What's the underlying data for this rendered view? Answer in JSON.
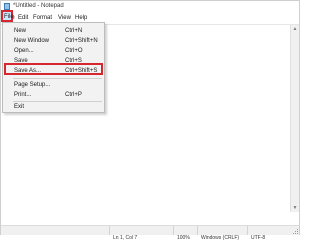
{
  "window": {
    "title": "*Untitled - Notepad"
  },
  "menubar": {
    "items": [
      "File",
      "Edit",
      "Format",
      "View",
      "Help"
    ]
  },
  "file_menu": {
    "items": [
      {
        "label": "New",
        "shortcut": "Ctrl+N"
      },
      {
        "label": "New Window",
        "shortcut": "Ctrl+Shift+N"
      },
      {
        "label": "Open...",
        "shortcut": "Ctrl+O"
      },
      {
        "label": "Save",
        "shortcut": "Ctrl+S"
      },
      {
        "label": "Save As...",
        "shortcut": "Ctrl+Shift+S"
      },
      {
        "label": "Page Setup...",
        "shortcut": ""
      },
      {
        "label": "Print...",
        "shortcut": "Ctrl+P"
      },
      {
        "label": "Exit",
        "shortcut": ""
      }
    ]
  },
  "statusbar": {
    "position": "Ln 1, Col 7",
    "zoom": "100%",
    "line_ending": "Windows (CRLF)",
    "encoding": "UTF-8"
  },
  "colors": {
    "highlight_outline": "#d6262f",
    "menu_active_bg": "#cce8ff"
  },
  "icons": {
    "app": "notepad-icon",
    "scroll_up": "scroll-up-arrow-icon",
    "scroll_down": "scroll-down-arrow-icon",
    "resize": "resize-grip-icon"
  }
}
